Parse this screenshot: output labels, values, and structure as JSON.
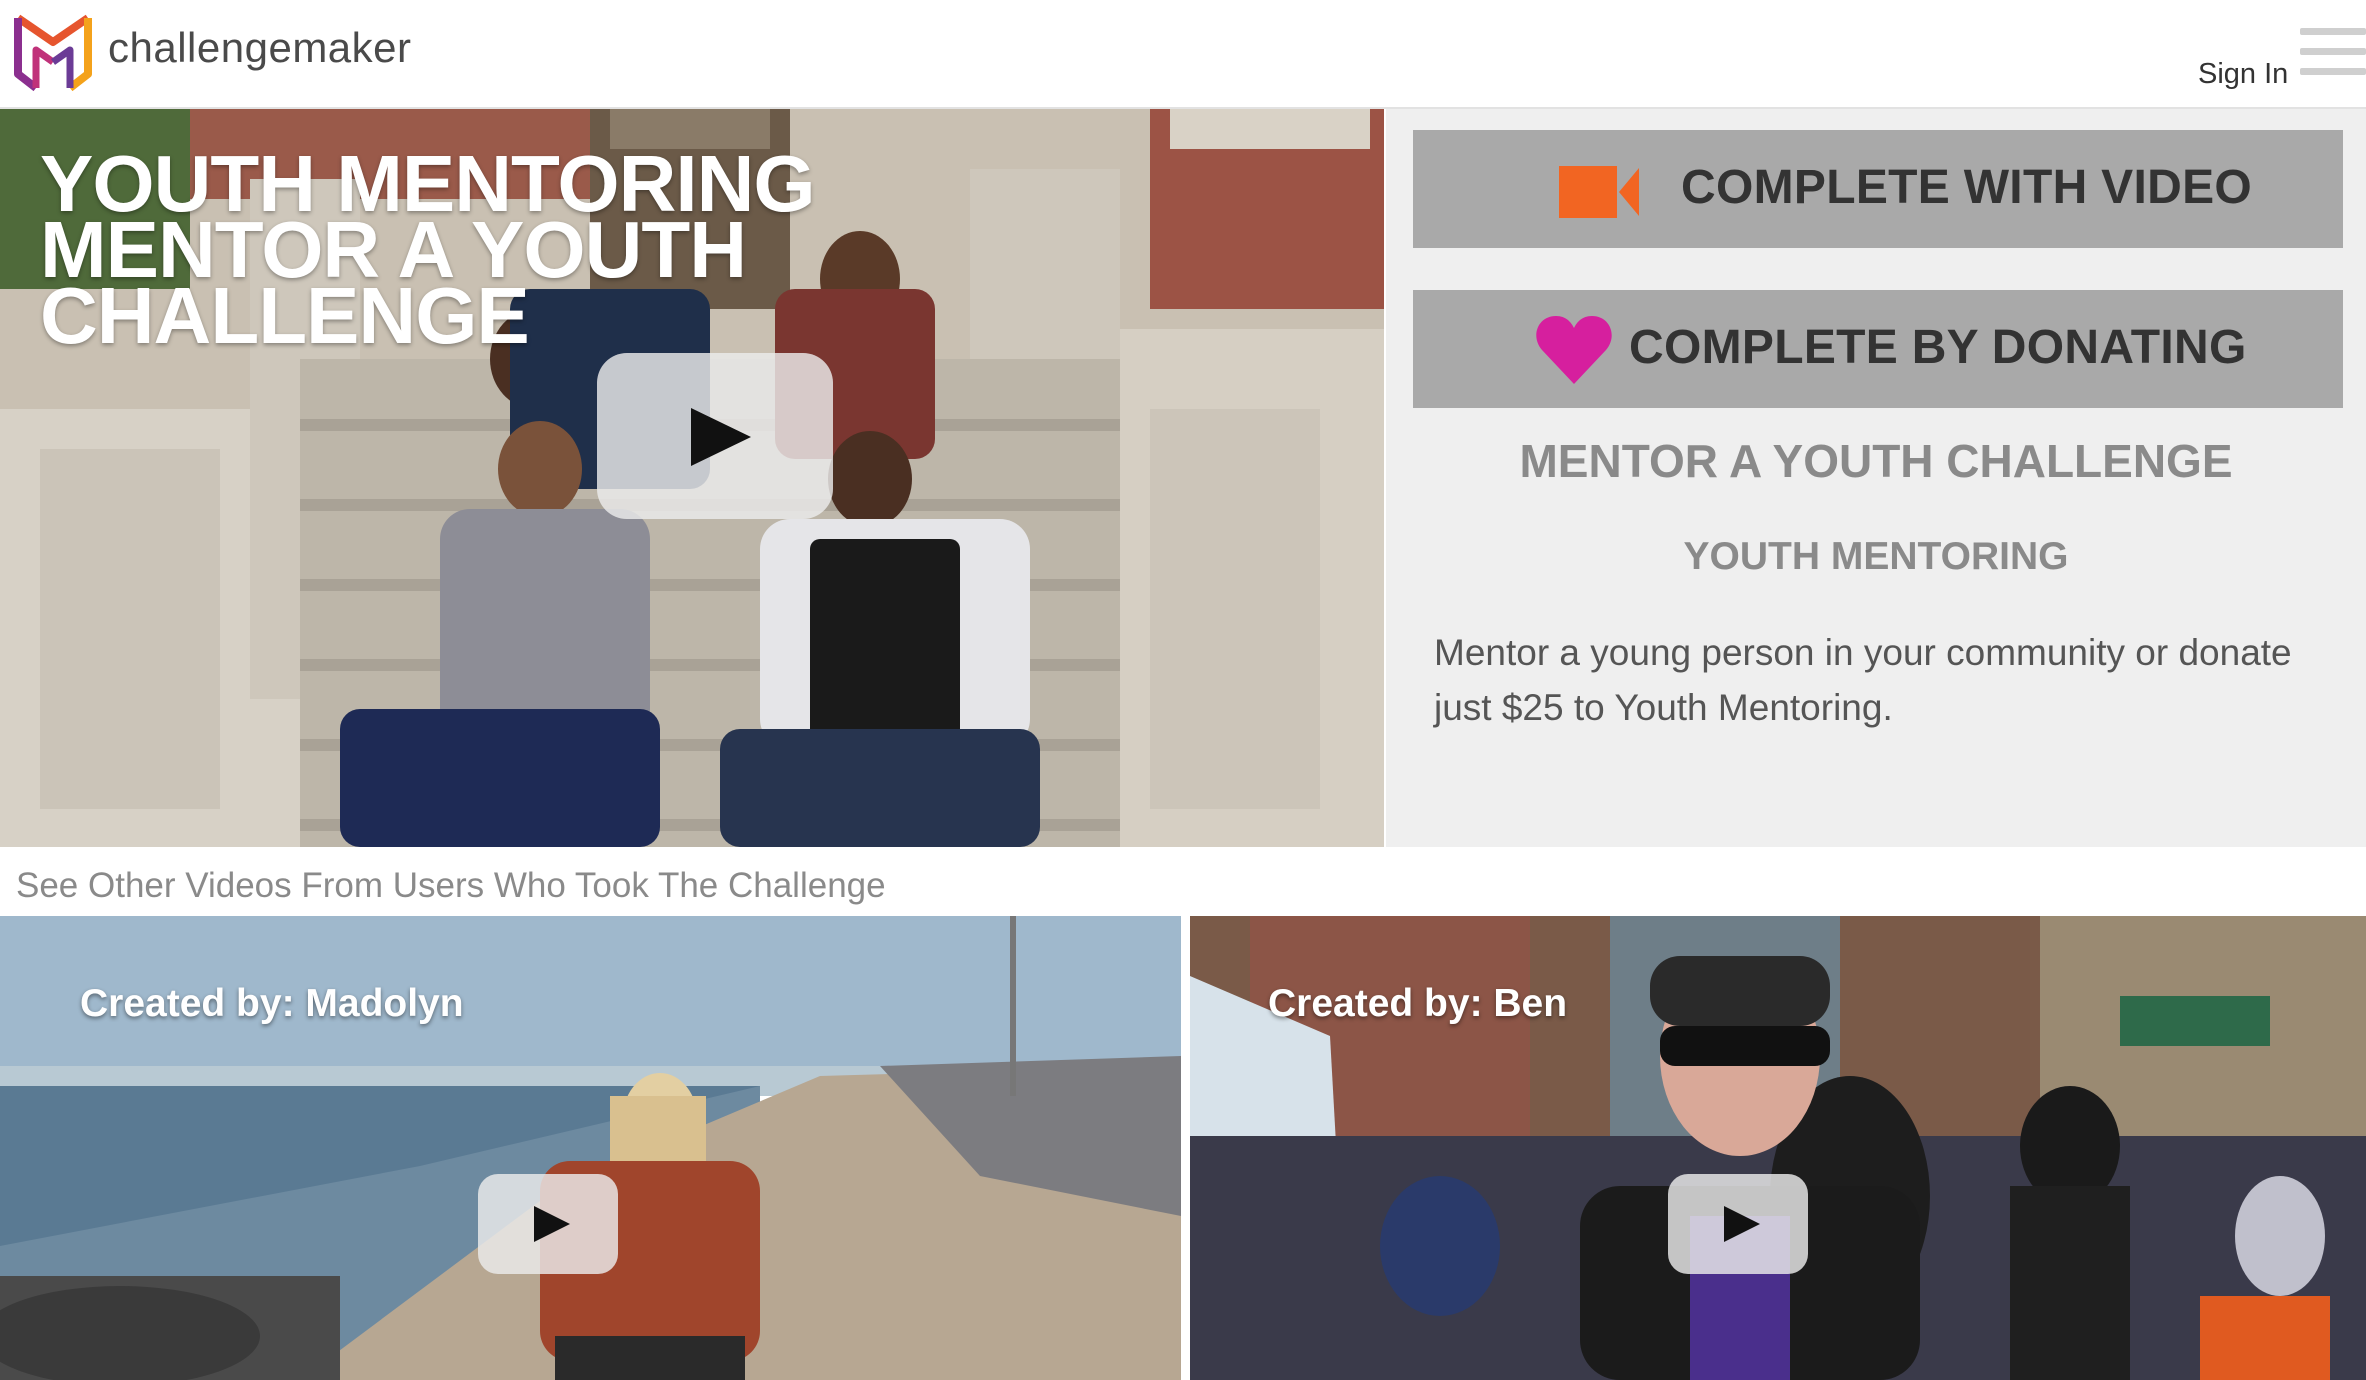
{
  "header": {
    "brand": "challengemaker",
    "sign_in": "Sign In",
    "logo_icon": "challengemaker-logo-icon",
    "menu_icon": "hamburger-menu-icon"
  },
  "hero": {
    "title_lines": [
      "YOUTH MENTORING",
      "MENTOR A YOUTH",
      "CHALLENGE"
    ],
    "play_icon": "play-icon"
  },
  "panel": {
    "complete_video_label": "COMPLETE WITH VIDEO",
    "complete_donate_label": "COMPLETE BY DONATING",
    "challenge_title": "MENTOR A YOUTH CHALLENGE",
    "org_title": "YOUTH MENTORING",
    "description": "Mentor a young person in your community or donate just $25 to Youth Mentoring.",
    "video_icon": "video-camera-icon",
    "donate_icon": "heart-icon"
  },
  "other_videos": {
    "heading": "See Other Videos From Users Who Took The Challenge",
    "items": [
      {
        "caption": "Created by: Madolyn"
      },
      {
        "caption": "Created by: Ben"
      }
    ]
  },
  "colors": {
    "button_bg": "#a9a9a9",
    "panel_bg": "#efefef",
    "video_icon": "#f26522",
    "heart_icon": "#d61f9e",
    "muted_text": "#8a8a8a"
  }
}
